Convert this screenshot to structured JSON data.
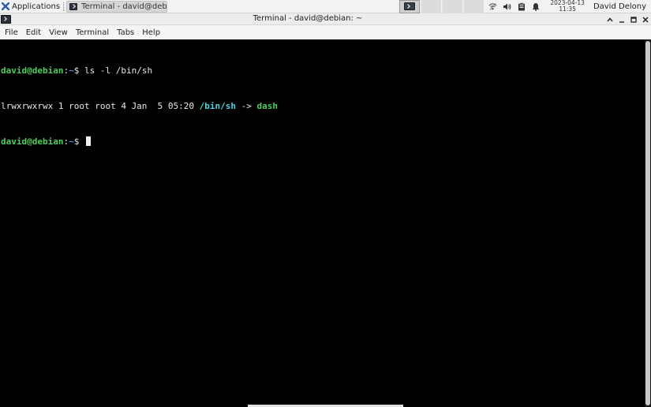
{
  "panel": {
    "applications_label": "Applications",
    "task_label": "Terminal - david@debia...",
    "clock_date": "2023-04-13",
    "clock_time": "11:35",
    "user_name": "David Delony",
    "tray_icons": [
      "network-icon",
      "volume-icon",
      "clipboard-icon",
      "notification-bell-icon"
    ]
  },
  "window": {
    "title": "Terminal - david@debian: ~",
    "controls": [
      "^",
      "–",
      "□",
      "×"
    ]
  },
  "menu": {
    "items": [
      "File",
      "Edit",
      "View",
      "Terminal",
      "Tabs",
      "Help"
    ]
  },
  "terminal": {
    "lines": [
      {
        "user_host": "david@debian",
        "path_sep": ":",
        "path": "~",
        "symbol": "$",
        "command": " ls -l /bin/sh"
      },
      {
        "output_prefix": "lrwxrwxrwx 1 root root 4 Jan  5 05:20 ",
        "link_name": "/bin/sh",
        "arrow": " -> ",
        "link_target": "dash"
      },
      {
        "user_host": "david@debian",
        "path_sep": ":",
        "path": "~",
        "symbol": "$",
        "command": " "
      }
    ]
  }
}
